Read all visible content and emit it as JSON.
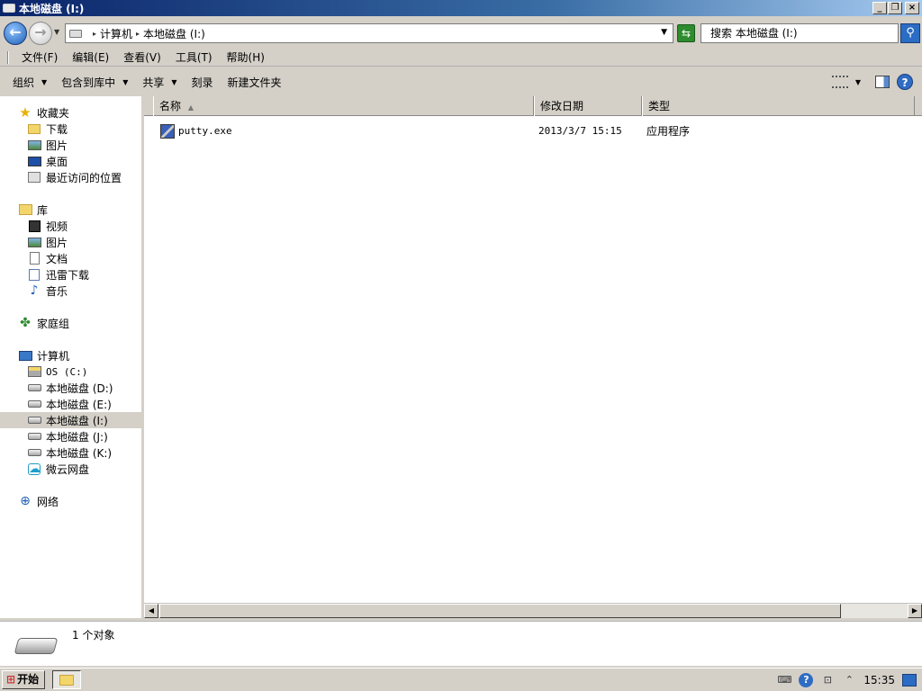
{
  "window": {
    "title": "本地磁盘 (I:)"
  },
  "address": {
    "segments": [
      "计算机",
      "本地磁盘 (I:)"
    ],
    "search_placeholder": "搜索 本地磁盘 (I:)"
  },
  "menu": [
    "文件(F)",
    "编辑(E)",
    "查看(V)",
    "工具(T)",
    "帮助(H)"
  ],
  "commands": {
    "organize": "组织",
    "include_in_library": "包含到库中",
    "share": "共享",
    "burn": "刻录",
    "new_folder": "新建文件夹"
  },
  "nav": {
    "favorites": "收藏夹",
    "favorites_items": [
      "下载",
      "图片",
      "桌面",
      "最近访问的位置"
    ],
    "libraries": "库",
    "libraries_items": [
      "视频",
      "图片",
      "文档",
      "迅雷下载",
      "音乐"
    ],
    "homegroup": "家庭组",
    "computer": "计算机",
    "computer_items": [
      "OS (C:)",
      "本地磁盘 (D:)",
      "本地磁盘 (E:)",
      "本地磁盘 (I:)",
      "本地磁盘 (J:)",
      "本地磁盘 (K:)",
      "微云网盘"
    ],
    "network": "网络"
  },
  "columns": {
    "name": "名称",
    "modified": "修改日期",
    "type": "类型"
  },
  "files": [
    {
      "name": "putty.exe",
      "modified": "2013/3/7 15:15",
      "type": "应用程序"
    }
  ],
  "details": {
    "count": "1 个对象"
  },
  "taskbar": {
    "start": "开始",
    "clock": "15:35"
  },
  "colors": {
    "title_gradient_start": "#0a246a",
    "title_gradient_end": "#a6caf0",
    "chrome": "#d4d0c8"
  }
}
